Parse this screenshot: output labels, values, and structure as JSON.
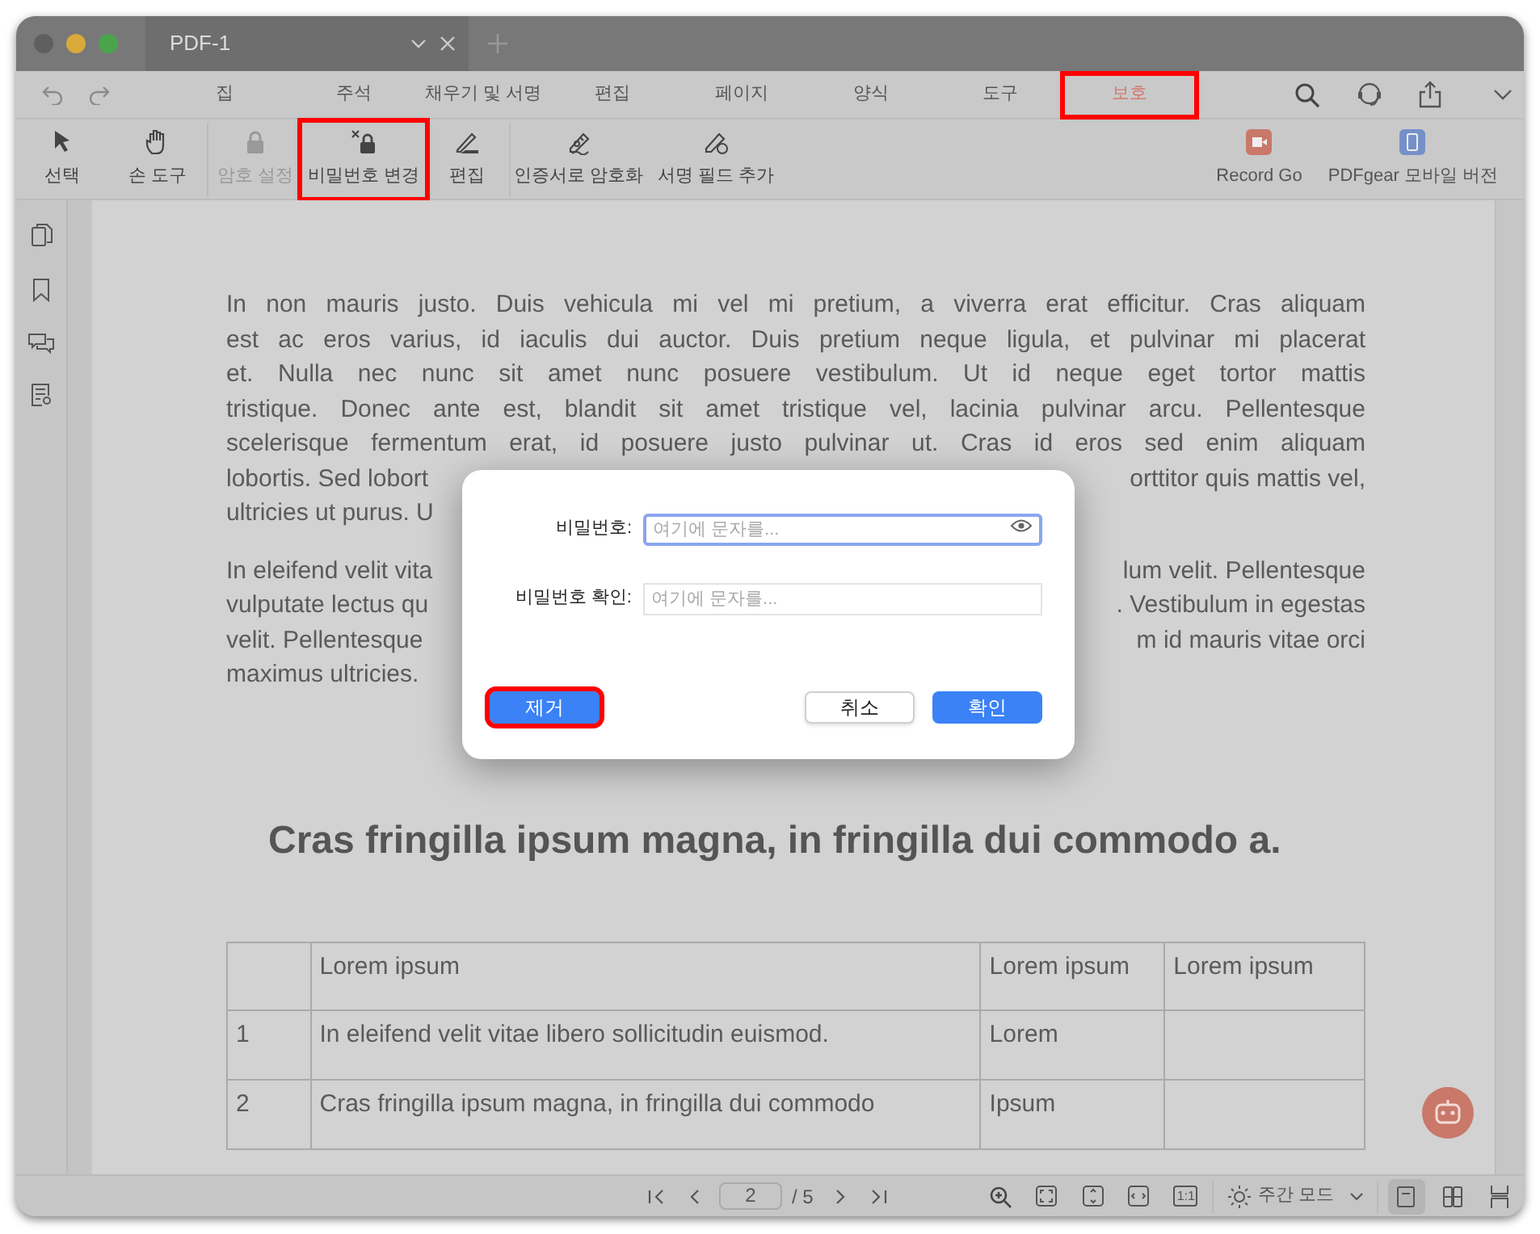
{
  "window": {
    "tabs": [
      {
        "title": "PDF-1",
        "selected": true
      }
    ]
  },
  "menu": [
    {
      "label": "집",
      "selected": false,
      "highlighted": false
    },
    {
      "label": "주석",
      "selected": false,
      "highlighted": false
    },
    {
      "label": "채우기 및 서명",
      "selected": false,
      "highlighted": false
    },
    {
      "label": "편집",
      "selected": false,
      "highlighted": false
    },
    {
      "label": "페이지",
      "selected": false,
      "highlighted": false
    },
    {
      "label": "양식",
      "selected": false,
      "highlighted": false
    },
    {
      "label": "도구",
      "selected": false,
      "highlighted": false
    },
    {
      "label": "보호",
      "selected": true,
      "highlighted": true
    }
  ],
  "toolbar": [
    {
      "label": "선택",
      "kind": "pointer",
      "disabled": false,
      "highlighted": false
    },
    {
      "label": "손 도구",
      "kind": "hand",
      "disabled": false,
      "highlighted": false
    },
    {
      "label": "암호 설정",
      "kind": "lock",
      "disabled": true,
      "highlighted": false
    },
    {
      "label": "비밀번호 변경",
      "kind": "lock-x",
      "disabled": false,
      "highlighted": true
    },
    {
      "label": "편집",
      "kind": "pen",
      "disabled": false,
      "highlighted": false
    },
    {
      "label": "인증서로 암호화",
      "kind": "cert",
      "disabled": false,
      "highlighted": false
    },
    {
      "label": "서명 필드 추가",
      "kind": "field",
      "disabled": false,
      "highlighted": false
    }
  ],
  "toolbar_right": [
    {
      "label": "Record Go",
      "kind": "record"
    },
    {
      "label": "PDFgear 모바일 버전",
      "kind": "mobile"
    }
  ],
  "document": {
    "paragraphs": [
      [
        {
          "left": "In non mauris justo. Duis vehicula mi vel mi pretium, a viverra erat efficitur. Cras aliquam"
        },
        {
          "left": "est ac eros varius, id iaculis dui auctor. Duis pretium neque ligula, et pulvinar mi placerat"
        },
        {
          "left": "et. Nulla nec nunc sit amet nunc posuere vestibulum. Ut id neque eget tortor mattis"
        },
        {
          "left": "tristique. Donec ante est, blandit sit amet tristique vel, lacinia pulvinar arcu. Pellentesque"
        },
        {
          "left": "scelerisque fermentum erat, id posuere justo pulvinar ut. Cras id eros sed enim aliquam"
        },
        {
          "left": "lobortis. Sed lobort",
          "right": "orttitor quis mattis vel,"
        },
        {
          "left": "ultricies ut purus. U"
        }
      ],
      [
        {
          "left": "In eleifend velit vita",
          "right": "lum velit. Pellentesque"
        },
        {
          "left": "vulputate lectus qu",
          "right": ". Vestibulum in egestas"
        },
        {
          "left": "velit. Pellentesque",
          "right": "m id mauris vitae orci"
        },
        {
          "left": "maximus ultricies."
        }
      ]
    ],
    "heading": "Cras fringilla ipsum magna, in fringilla dui commodo a.",
    "table": {
      "columns": [
        "",
        "Lorem ipsum",
        "Lorem ipsum",
        "Lorem ipsum"
      ],
      "rows": [
        [
          "1",
          "In eleifend velit vitae libero sollicitudin euismod.",
          "Lorem",
          ""
        ],
        [
          "2",
          "Cras fringilla ipsum magna, in fringilla dui commodo",
          "Ipsum",
          ""
        ]
      ]
    }
  },
  "dialog": {
    "fields": [
      {
        "label": "비밀번호:",
        "placeholder": "여기에 문자를...",
        "focused": true,
        "reveal": true
      },
      {
        "label": "비밀번호 확인:",
        "placeholder": "여기에 문자를...",
        "focused": false,
        "reveal": false
      }
    ],
    "buttons": [
      {
        "label": "제거",
        "kind": "primary",
        "highlighted": true
      },
      {
        "label": "취소",
        "kind": "secondary",
        "highlighted": false
      },
      {
        "label": "확인",
        "kind": "primary",
        "highlighted": false
      }
    ]
  },
  "status_bar": {
    "page": "2",
    "total": "/ 5",
    "zoom_label": "1:1",
    "mode": "주간 모드",
    "views": [
      {
        "kind": "single",
        "selected": true
      },
      {
        "kind": "double",
        "selected": false
      },
      {
        "kind": "scroll",
        "selected": false
      }
    ]
  }
}
